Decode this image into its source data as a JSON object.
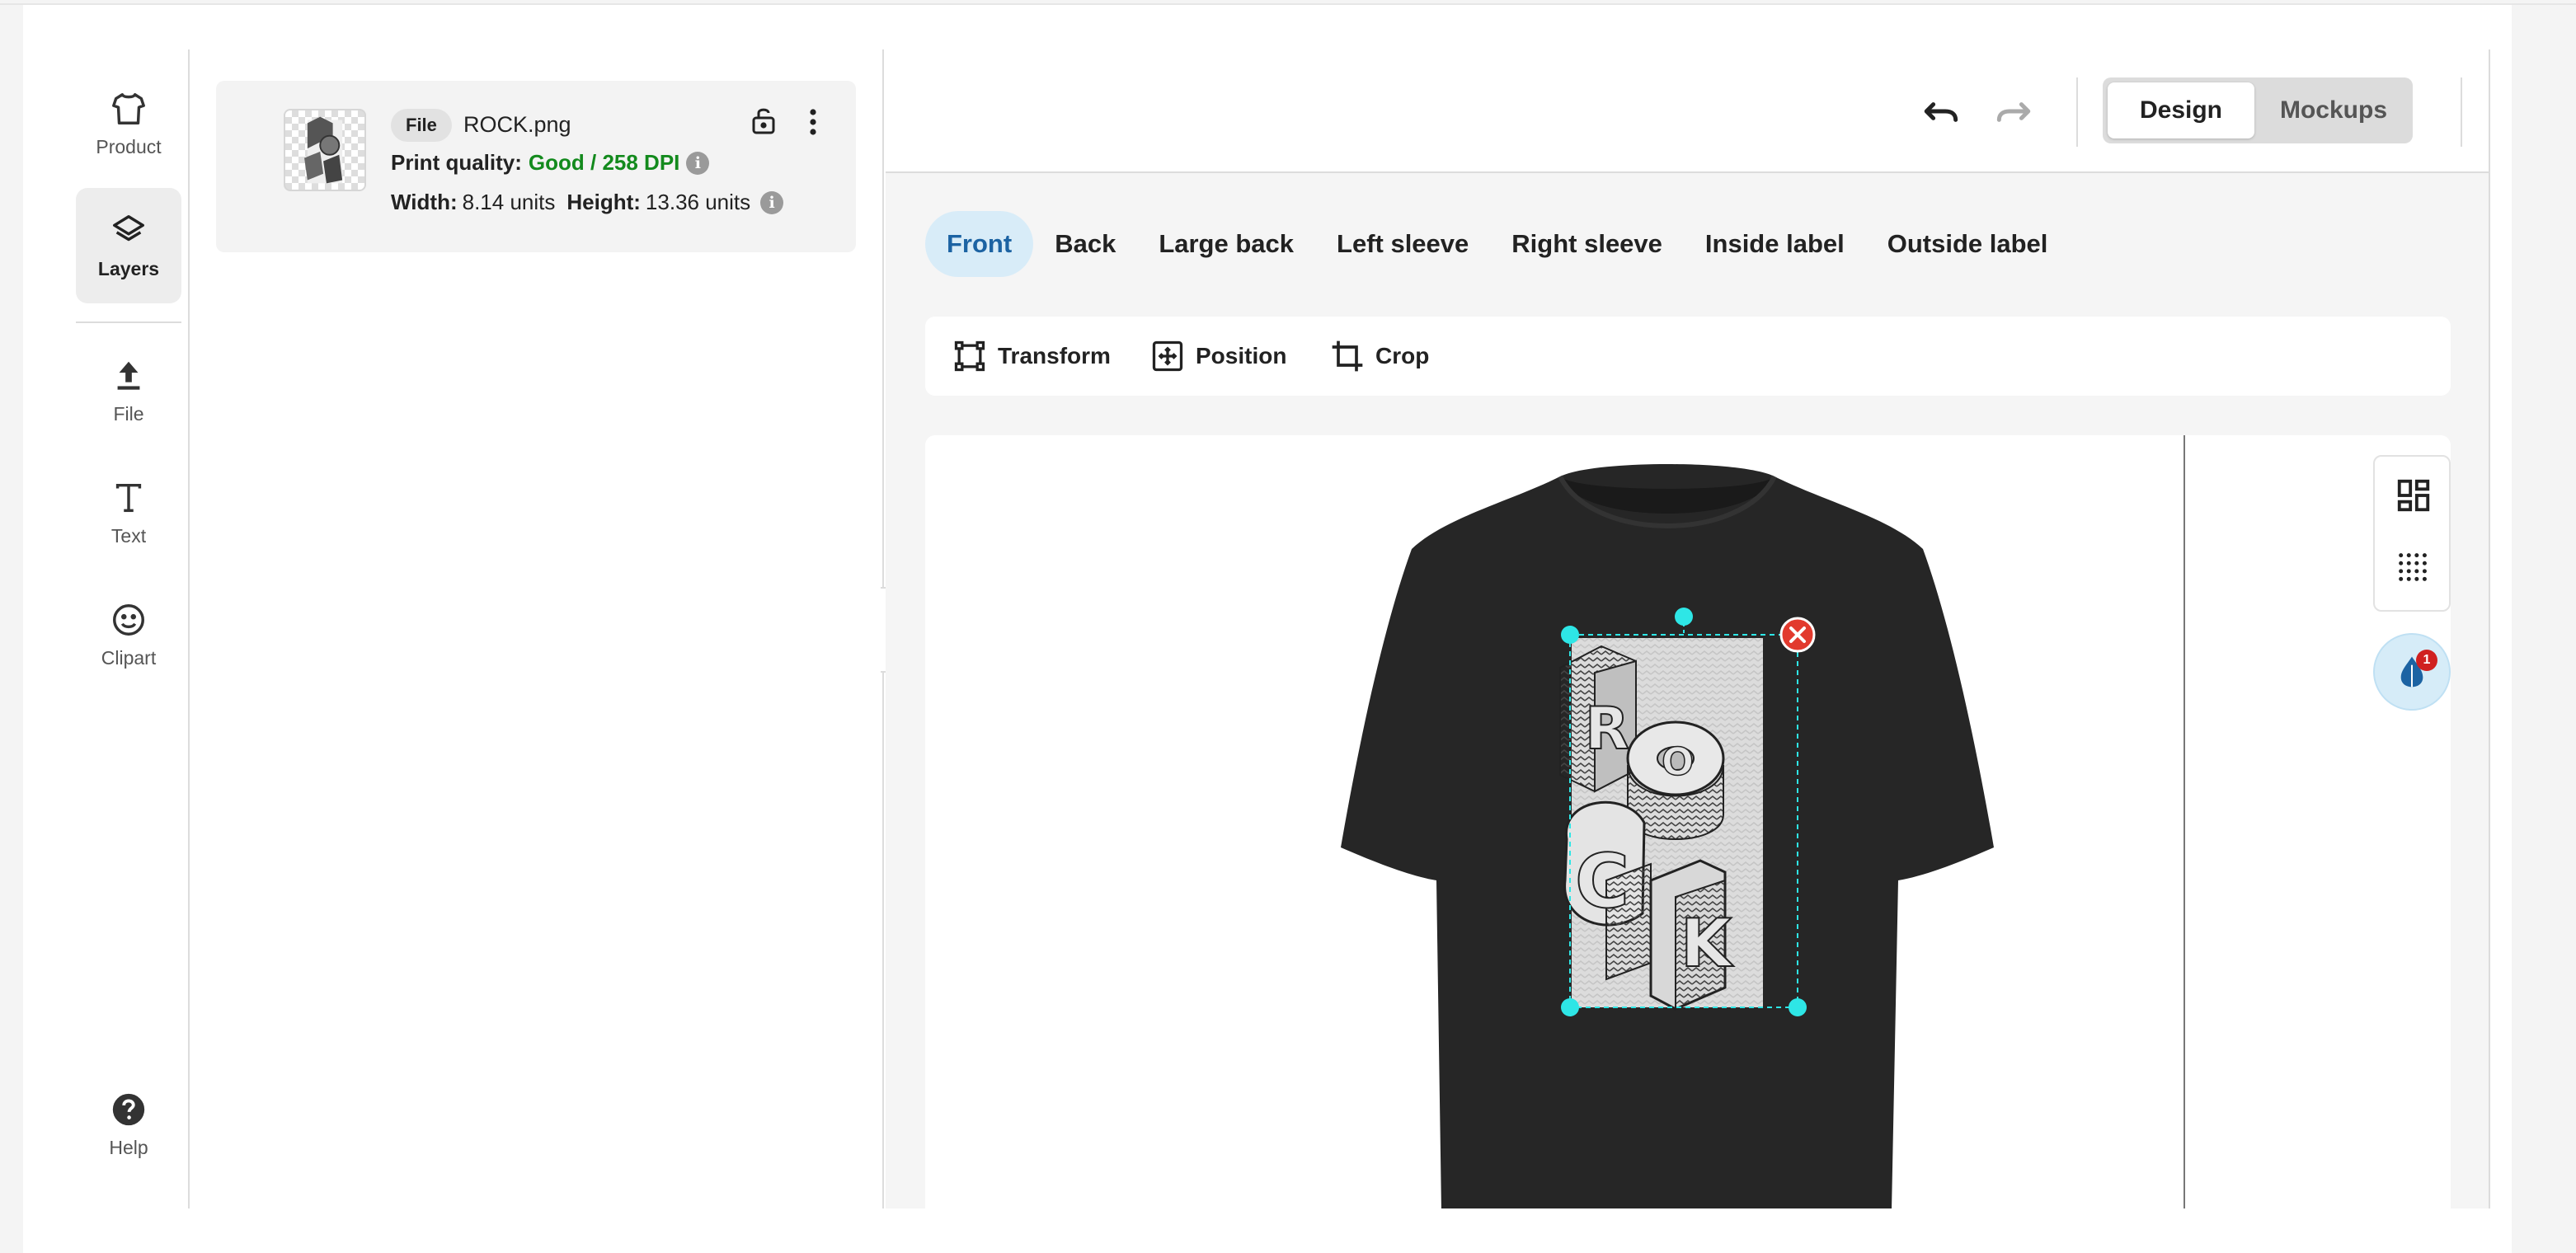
{
  "rail": {
    "product": "Product",
    "layers": "Layers",
    "file": "File",
    "text": "Text",
    "clipart": "Clipart",
    "help": "Help"
  },
  "layer": {
    "badge": "File",
    "filename": "ROCK.png",
    "quality_label": "Print quality:",
    "quality_value": "Good / 258 DPI",
    "width_label": "Width:",
    "width_value": "8.14 units",
    "height_label": "Height:",
    "height_value": "13.36 units"
  },
  "toolbar": {
    "design": "Design",
    "mockups": "Mockups"
  },
  "placements": [
    "Front",
    "Back",
    "Large back",
    "Left sleeve",
    "Right sleeve",
    "Inside label",
    "Outside label"
  ],
  "active_placement": "Front",
  "tools": {
    "transform": "Transform",
    "position": "Position",
    "crop": "Crop"
  },
  "design_text": {
    "l1": "R",
    "l2": "O",
    "l3": "C",
    "l4": "K"
  },
  "notification_count": "1",
  "colors": {
    "accent": "#1c63a3",
    "selection": "#2ee6e6",
    "good": "#138a1d",
    "shirt": "#262626",
    "delete": "#e23a2e"
  }
}
